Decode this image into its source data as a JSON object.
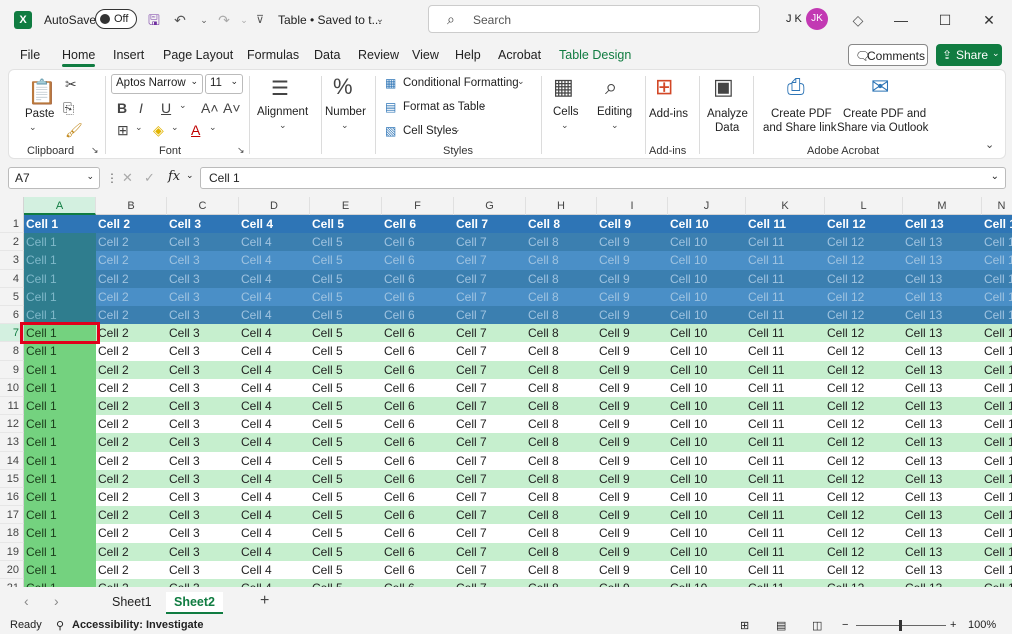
{
  "titlebar": {
    "autosave_label": "AutoSave",
    "autosave_state": "Off",
    "doc_title": "Table • Saved to t...",
    "search_placeholder": "Search",
    "user_initials": "J K",
    "avatar_text": "JK"
  },
  "menu": {
    "tabs": [
      "File",
      "Home",
      "Insert",
      "Page Layout",
      "Formulas",
      "Data",
      "Review",
      "View",
      "Help",
      "Acrobat",
      "Table Design"
    ],
    "active": "Home",
    "comments_label": "Comments",
    "share_label": "Share"
  },
  "ribbon": {
    "clipboard": {
      "paste": "Paste",
      "label": "Clipboard"
    },
    "font": {
      "name": "Aptos Narrow",
      "size": "11",
      "label": "Font"
    },
    "alignment": "Alignment",
    "number": "Number",
    "styles": {
      "conditional": "Conditional Formatting",
      "format_table": "Format as Table",
      "cell_styles": "Cell Styles",
      "label": "Styles"
    },
    "cells": "Cells",
    "editing": "Editing",
    "addins": {
      "button": "Add-ins",
      "label": "Add-ins"
    },
    "analyze": {
      "line1": "Analyze",
      "line2": "Data"
    },
    "acrobat": {
      "pdf_link_1": "Create PDF",
      "pdf_link_2": "and Share link",
      "pdf_outlook_1": "Create PDF and",
      "pdf_outlook_2": "Share via Outlook",
      "label": "Adobe Acrobat"
    }
  },
  "formula_bar": {
    "name_box": "A7",
    "fx": "fx",
    "content": "Cell 1"
  },
  "grid": {
    "columns": [
      "A",
      "B",
      "C",
      "D",
      "E",
      "F",
      "G",
      "H",
      "I",
      "J",
      "K",
      "L",
      "M",
      "N"
    ],
    "selected_column": "A",
    "selected_row": "7",
    "rows": [
      "1",
      "2",
      "3",
      "4",
      "5",
      "6",
      "7",
      "8",
      "9",
      "10",
      "11",
      "12",
      "13",
      "14",
      "15",
      "16",
      "17",
      "18",
      "19",
      "20",
      "21"
    ],
    "cell_values": [
      "Cell 1",
      "Cell 2",
      "Cell 3",
      "Cell 4",
      "Cell 5",
      "Cell 6",
      "Cell 7",
      "Cell 8",
      "Cell 9",
      "Cell 10",
      "Cell 11",
      "Cell 12",
      "Cell 13",
      "Cell 1"
    ],
    "colors": {
      "header_band": "#2e75b6",
      "blue_dark": "#3b7fb0",
      "blue_light": "#4a8fc7",
      "green_light": "#c6efce",
      "white": "#ffffff",
      "col_a": "#74d27f",
      "selection_outline": "#e0001b"
    }
  },
  "sheets": {
    "tabs": [
      "Sheet1",
      "Sheet2"
    ],
    "active": "Sheet2"
  },
  "status": {
    "ready": "Ready",
    "accessibility": "Accessibility: Investigate",
    "zoom": "100%"
  }
}
